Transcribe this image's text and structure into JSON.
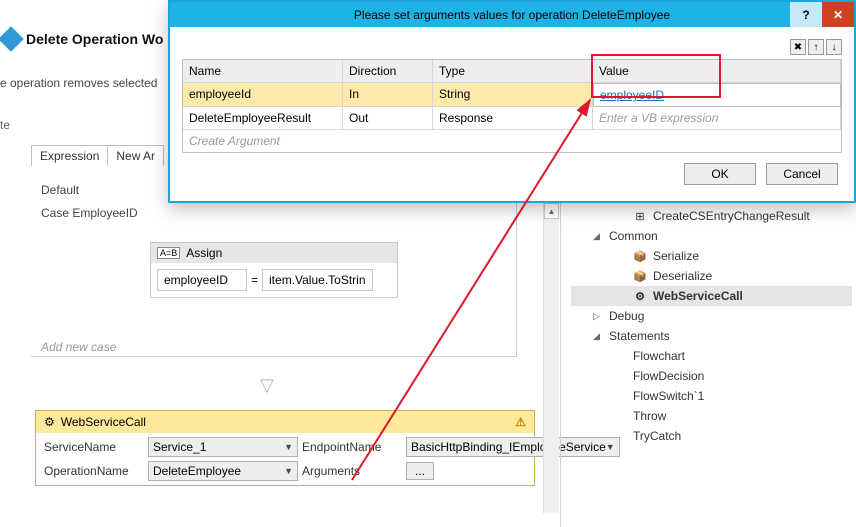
{
  "bg": {
    "title": "Delete Operation Wo",
    "subtitle": "e operation removes selected",
    "delete": "te",
    "tabs": [
      "Expression",
      "New Ar"
    ],
    "default": "Default",
    "case": "Case  EmployeeID",
    "assign": {
      "title": "Assign",
      "left": "employeeID",
      "op": "=",
      "right": "item.Value.ToStrin"
    },
    "add_case": "Add new case",
    "wsc": {
      "title": "WebServiceCall",
      "serviceNameLbl": "ServiceName",
      "serviceName": "Service_1",
      "endpointLbl": "EndpointName",
      "endpoint": "BasicHttpBinding_IEmployeeService",
      "operationLbl": "OperationName",
      "operation": "DeleteEmployee",
      "argumentsLbl": "Arguments",
      "arguments": "..."
    }
  },
  "tree": {
    "items": [
      {
        "label": "CreateCSEntryChangeResult",
        "exp": "",
        "indent": 2,
        "icon": "⊞",
        "sel": false
      },
      {
        "label": "Common",
        "exp": "◢",
        "indent": 1,
        "icon": "",
        "sel": false
      },
      {
        "label": "Serialize",
        "exp": "",
        "indent": 2,
        "icon": "📦",
        "sel": false
      },
      {
        "label": "Deserialize",
        "exp": "",
        "indent": 2,
        "icon": "📦",
        "sel": false
      },
      {
        "label": "WebServiceCall",
        "exp": "",
        "indent": 2,
        "icon": "⚙",
        "sel": true
      },
      {
        "label": "Debug",
        "exp": "▷",
        "indent": 1,
        "icon": "",
        "sel": false
      },
      {
        "label": "Statements",
        "exp": "◢",
        "indent": 1,
        "icon": "",
        "sel": false
      },
      {
        "label": "Flowchart",
        "exp": "",
        "indent": 2,
        "icon": "",
        "sel": false
      },
      {
        "label": "FlowDecision",
        "exp": "",
        "indent": 2,
        "icon": "",
        "sel": false
      },
      {
        "label": "FlowSwitch`1",
        "exp": "",
        "indent": 2,
        "icon": "",
        "sel": false
      },
      {
        "label": "Throw",
        "exp": "",
        "indent": 2,
        "icon": "",
        "sel": false
      },
      {
        "label": "TryCatch",
        "exp": "",
        "indent": 2,
        "icon": "",
        "sel": false
      }
    ]
  },
  "dialog": {
    "title": "Please set arguments values for operation DeleteEmployee",
    "headers": {
      "name": "Name",
      "direction": "Direction",
      "type": "Type",
      "value": "Value"
    },
    "rows": [
      {
        "name": "employeeId",
        "direction": "In",
        "type": "String",
        "value": "employeeID",
        "sel": true
      },
      {
        "name": "DeleteEmployeeResult",
        "direction": "Out",
        "type": "Response",
        "value": "Enter a VB expression",
        "sel": false
      }
    ],
    "create": "Create Argument",
    "ok": "OK",
    "cancel": "Cancel"
  }
}
